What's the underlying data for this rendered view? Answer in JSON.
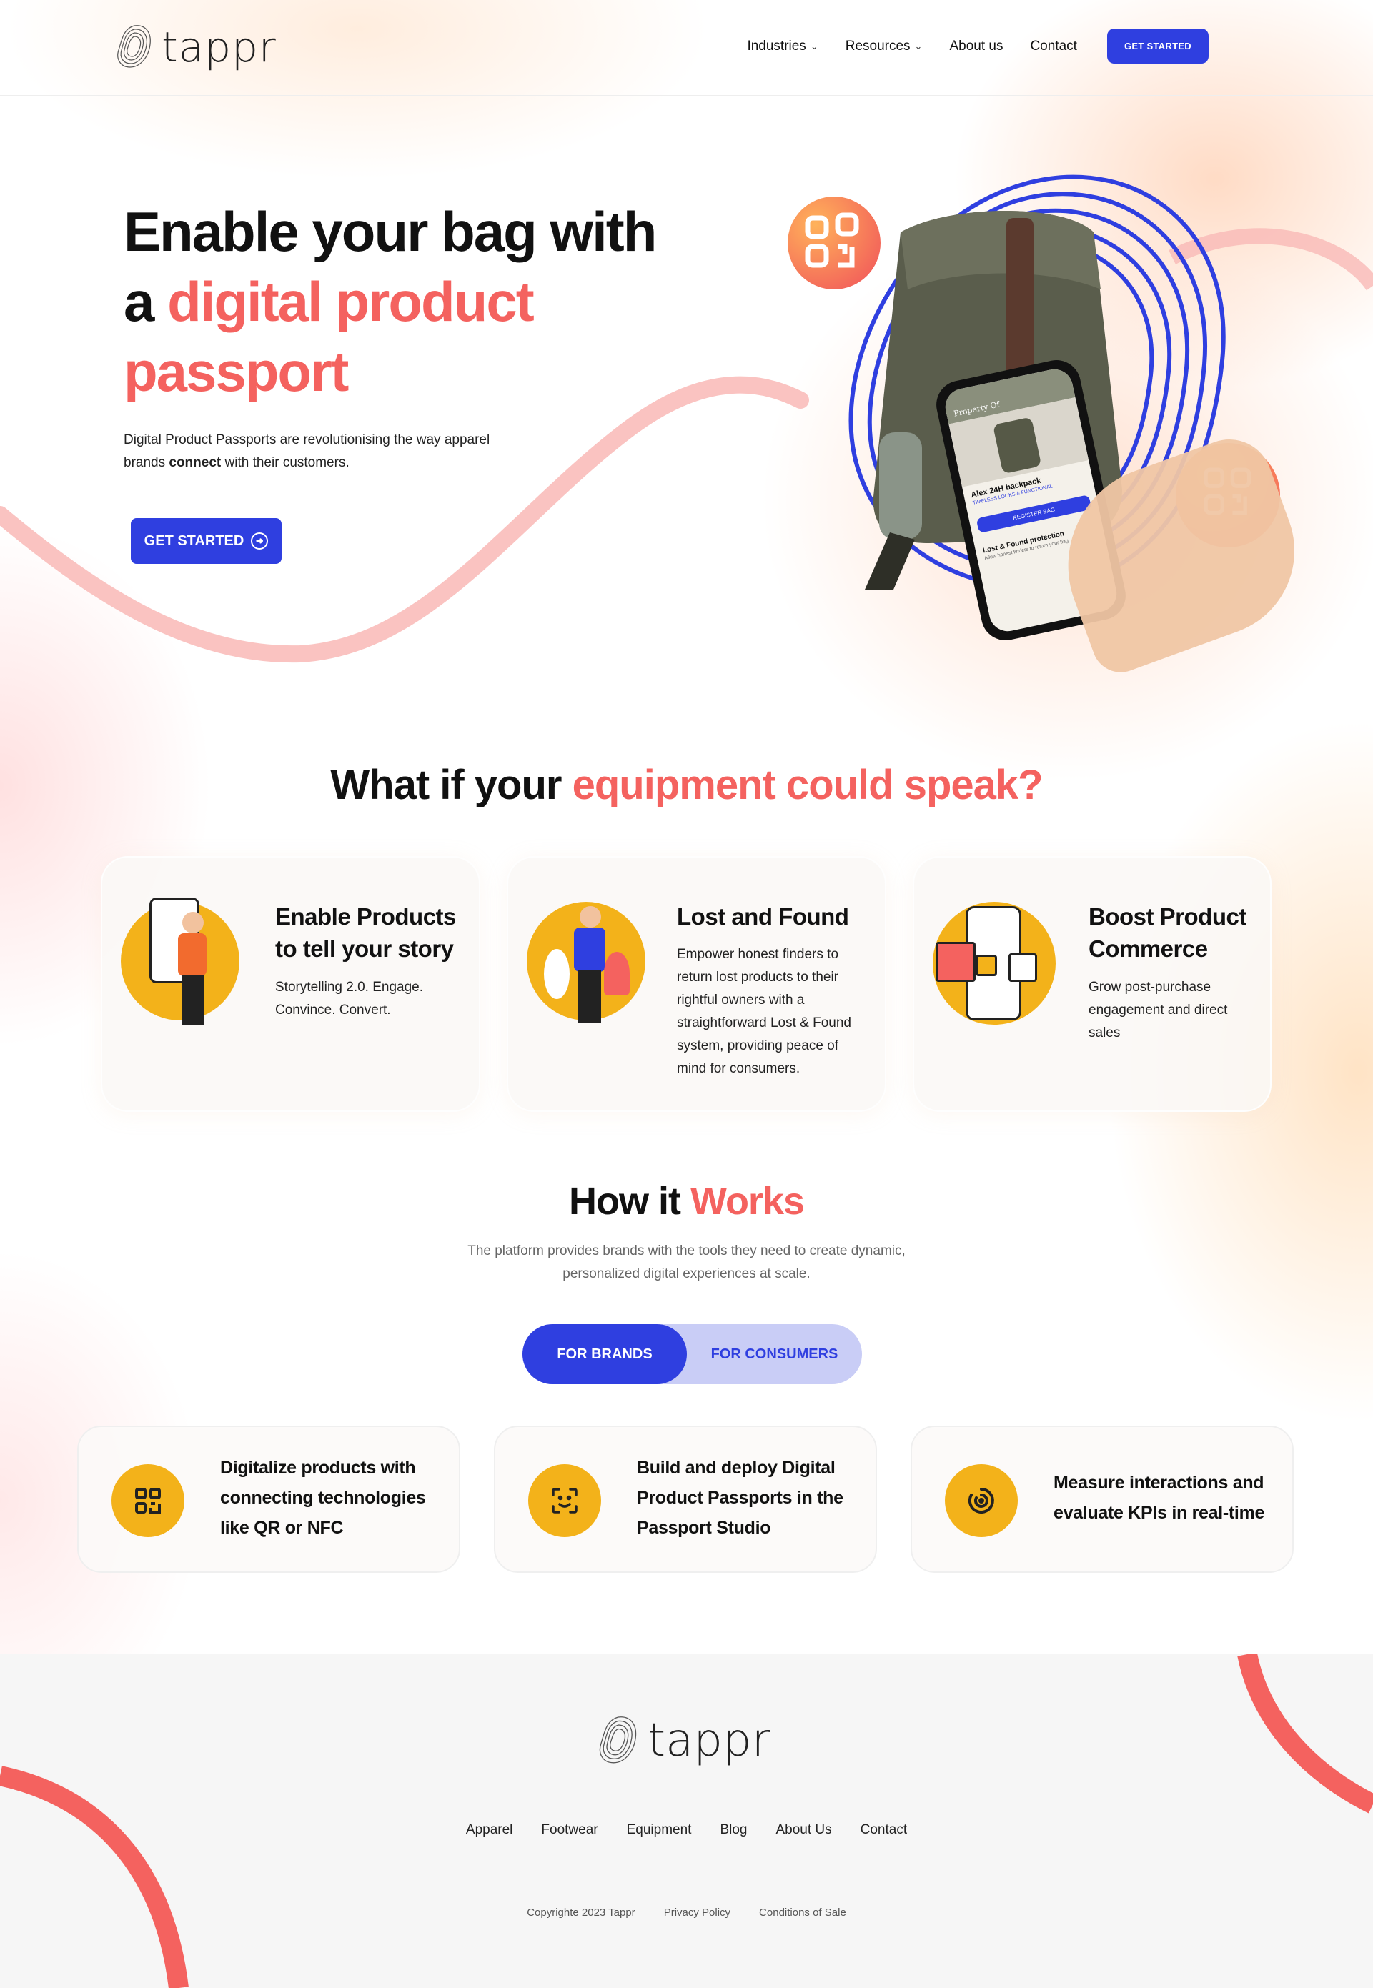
{
  "brand": {
    "name": "tappr"
  },
  "nav": {
    "items": [
      {
        "label": "Industries",
        "dropdown": true
      },
      {
        "label": "Resources",
        "dropdown": true
      },
      {
        "label": "About us",
        "dropdown": false
      },
      {
        "label": "Contact",
        "dropdown": false
      }
    ],
    "cta": "GET STARTED"
  },
  "hero": {
    "title_line1": "Enable your bag with",
    "title_a": "a ",
    "title_highlight_1": "digital product",
    "title_highlight_2": "passport",
    "desc_pre": "Digital Product Passports are revolutionising the way apparel brands ",
    "desc_bold": "connect",
    "desc_post": " with their customers.",
    "cta": "GET STARTED",
    "phone": {
      "header": "Property Of",
      "product": "Alex 24H backpack",
      "tag": "TIMELESS LOOKS & FUNCTIONAL",
      "button": "REGISTER BAG",
      "section": "Lost & Found protection",
      "section_sub": "Allow honest finders to return your bag"
    }
  },
  "speak": {
    "title_plain": "What if your ",
    "title_highlight": "equipment could speak?",
    "cards": [
      {
        "title": "Enable Products to tell your story",
        "text": "Storytelling 2.0. Engage. Convince. Convert.",
        "icon": "person-register-illustration"
      },
      {
        "title": "Lost and Found",
        "text": "Empower honest finders to return lost products to their rightful owners with a straightforward Lost & Found system, providing peace of mind for consumers.",
        "icon": "person-found-illustration"
      },
      {
        "title": "Boost Product Commerce",
        "text": "Grow post-purchase engagement and direct sales",
        "icon": "shop-phone-illustration"
      }
    ]
  },
  "how": {
    "title_plain": "How it ",
    "title_highlight": "Works",
    "subtitle_1": "The platform provides brands with the tools they need to create dynamic,",
    "subtitle_2": "personalized digital experiences at scale.",
    "tabs": [
      "FOR BRANDS",
      "FOR CONSUMERS"
    ],
    "active_tab": "FOR BRANDS",
    "features": [
      {
        "title": "Digitalize products with connecting technologies like QR or NFC",
        "icon": "qr-code-icon"
      },
      {
        "title": "Build and deploy Digital Product Passports in the Passport Studio",
        "icon": "face-scan-icon"
      },
      {
        "title": "Measure interactions and evaluate KPIs in real-time",
        "icon": "target-icon"
      }
    ]
  },
  "footer": {
    "links": [
      "Apparel",
      "Footwear",
      "Equipment",
      "Blog",
      "About Us",
      "Contact"
    ],
    "copyright": "Copyrighte 2023 Tappr",
    "privacy": "Privacy Policy",
    "conditions": "Conditions of Sale"
  },
  "colors": {
    "accent": "#2f3fe0",
    "coral": "#f4625f",
    "yellow": "#f3b21a"
  }
}
